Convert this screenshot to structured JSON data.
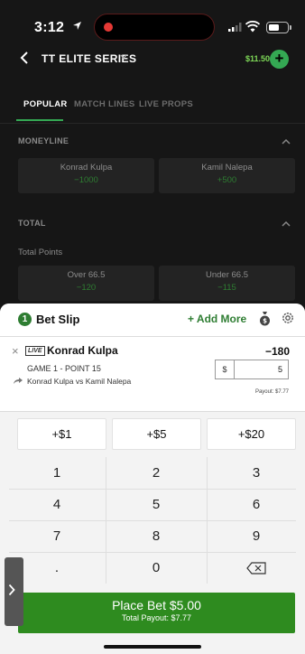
{
  "status": {
    "time": "3:12"
  },
  "nav": {
    "title": "TT ELITE SERIES",
    "balance": "$11.50",
    "add_symbol": "+"
  },
  "tabs": [
    {
      "label": "POPULAR",
      "active": true
    },
    {
      "label": "MATCH LINES",
      "active": false
    },
    {
      "label": "LIVE PROPS",
      "active": false
    }
  ],
  "moneyline": {
    "label": "MONEYLINE",
    "options": [
      {
        "name": "Konrad Kulpa",
        "price": "−1000"
      },
      {
        "name": "Kamil Nalepa",
        "price": "+500"
      }
    ]
  },
  "total": {
    "label": "TOTAL",
    "sub_label": "Total Points",
    "options": [
      {
        "name": "Over 66.5",
        "price": "−120"
      },
      {
        "name": "Under 66.5",
        "price": "−115"
      }
    ]
  },
  "bet_slip": {
    "count": "1",
    "title": "Bet Slip",
    "add_more": "+ Add More",
    "selection": {
      "live_badge": "LIVE",
      "name": "Konrad Kulpa",
      "odds": "−180",
      "market": "GAME 1 - POINT 15",
      "event": "Konrad Kulpa vs Kamil Nalepa",
      "currency": "$",
      "stake": "5",
      "payout": "Payout: $7.77"
    },
    "quick_amounts": [
      "+$1",
      "+$5",
      "+$20"
    ],
    "keypad": {
      "k1": "1",
      "k2": "2",
      "k3": "3",
      "k4": "4",
      "k5": "5",
      "k6": "6",
      "k7": "7",
      "k8": "8",
      "k9": "9",
      "dot": ".",
      "k0": "0"
    },
    "place_bet": {
      "label": "Place Bet $5.00",
      "payout": "Total Payout: $7.77"
    }
  },
  "colors": {
    "accent": "#2e8b1f",
    "odds_green": "#2e7d32",
    "background": "#161616"
  }
}
